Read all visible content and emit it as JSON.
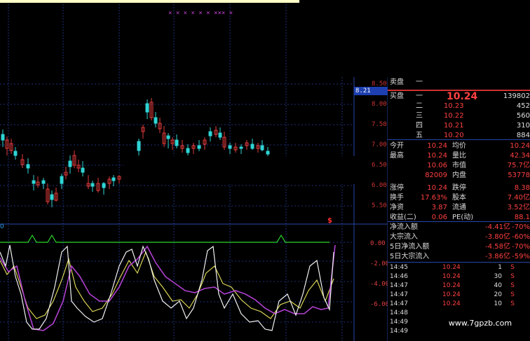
{
  "colors": {
    "up": "#e03a3a",
    "down": "#2fd5d5",
    "grid": "#1c2f78",
    "green_line": "#2bd82b",
    "line_white": "#f0f0f0",
    "line_yellow": "#e6e05a",
    "line_magenta": "#b040d0"
  },
  "markers_top": "×  ×  ×     ×     ×   ×    ×××    ×",
  "upper_axis": [
    "8.50",
    "8.00",
    "7.50",
    "7.00",
    "6.50",
    "6.00",
    "5.50"
  ],
  "price_tag": "8.21",
  "lower_axis": [
    "0.00",
    "-2.00",
    "-4.00",
    "-6.00"
  ],
  "lower_left_label": "0",
  "mark_5": "$",
  "order_book": {
    "sell_label": "卖盘",
    "sell_level": "一",
    "buy_label": "买盘",
    "levels": [
      {
        "name": "一",
        "price": "10.24",
        "vol": "139802"
      },
      {
        "name": "二",
        "price": "10.23",
        "vol": "452"
      },
      {
        "name": "三",
        "price": "10.22",
        "vol": "560"
      },
      {
        "name": "四",
        "price": "10.21",
        "vol": "310"
      },
      {
        "name": "五",
        "price": "10.20",
        "vol": "884"
      }
    ]
  },
  "quote": [
    {
      "l1": "今开",
      "v1": "10.24",
      "l2": "均价",
      "v2": "10.24"
    },
    {
      "l1": "最高",
      "v1": "10.24",
      "l2": "量比",
      "v2": "42.34"
    },
    {
      "l1": "",
      "v1": "10.06",
      "l2": "市值",
      "v2": "75.7亿"
    },
    {
      "l1": "",
      "v1": "82009",
      "l2": "内盘",
      "v2": "53778"
    },
    {
      "l1": "涨停",
      "v1": "10.24",
      "l2": "跌停",
      "v2": "8.38"
    },
    {
      "l1": "换手",
      "v1": "17.63%",
      "l2": "股本",
      "v2": "7.40亿"
    },
    {
      "l1": "净资",
      "v1": "3.87",
      "l2": "流通",
      "v2": "3.52亿"
    },
    {
      "l1": "收益(二)",
      "v1": "0.06",
      "l2": "PE(动)",
      "v2": "88.1"
    }
  ],
  "flows": [
    {
      "label": "净流入额",
      "value": "-4.41亿",
      "pct": "-70%"
    },
    {
      "label": "大宗流入",
      "value": "-3.80亿",
      "pct": "-60%"
    },
    {
      "label": "5日净流入额",
      "value": "-4.58亿",
      "pct": "-70%"
    },
    {
      "label": "5日大宗流入",
      "value": "-3.86亿",
      "pct": "-59%"
    }
  ],
  "ticks": [
    {
      "t": "14:45",
      "p": "10.24",
      "v": "1",
      "f": "S"
    },
    {
      "t": "14:46",
      "p": "10.24",
      "v": "30",
      "f": "S"
    },
    {
      "t": "14:47",
      "p": "10.24",
      "v": "40",
      "f": "S"
    },
    {
      "t": "14:47",
      "p": "10.24",
      "v": "20",
      "f": "S"
    },
    {
      "t": "14:47",
      "p": "10.24",
      "v": "10",
      "f": "S"
    },
    {
      "t": "14:48",
      "p": "",
      "v": "",
      "f": ""
    },
    {
      "t": "14:49",
      "p": "",
      "v": "",
      "f": ""
    },
    {
      "t": "14:49",
      "p": "",
      "v": "",
      "f": ""
    }
  ],
  "watermark": "www.7gpzb.com"
}
